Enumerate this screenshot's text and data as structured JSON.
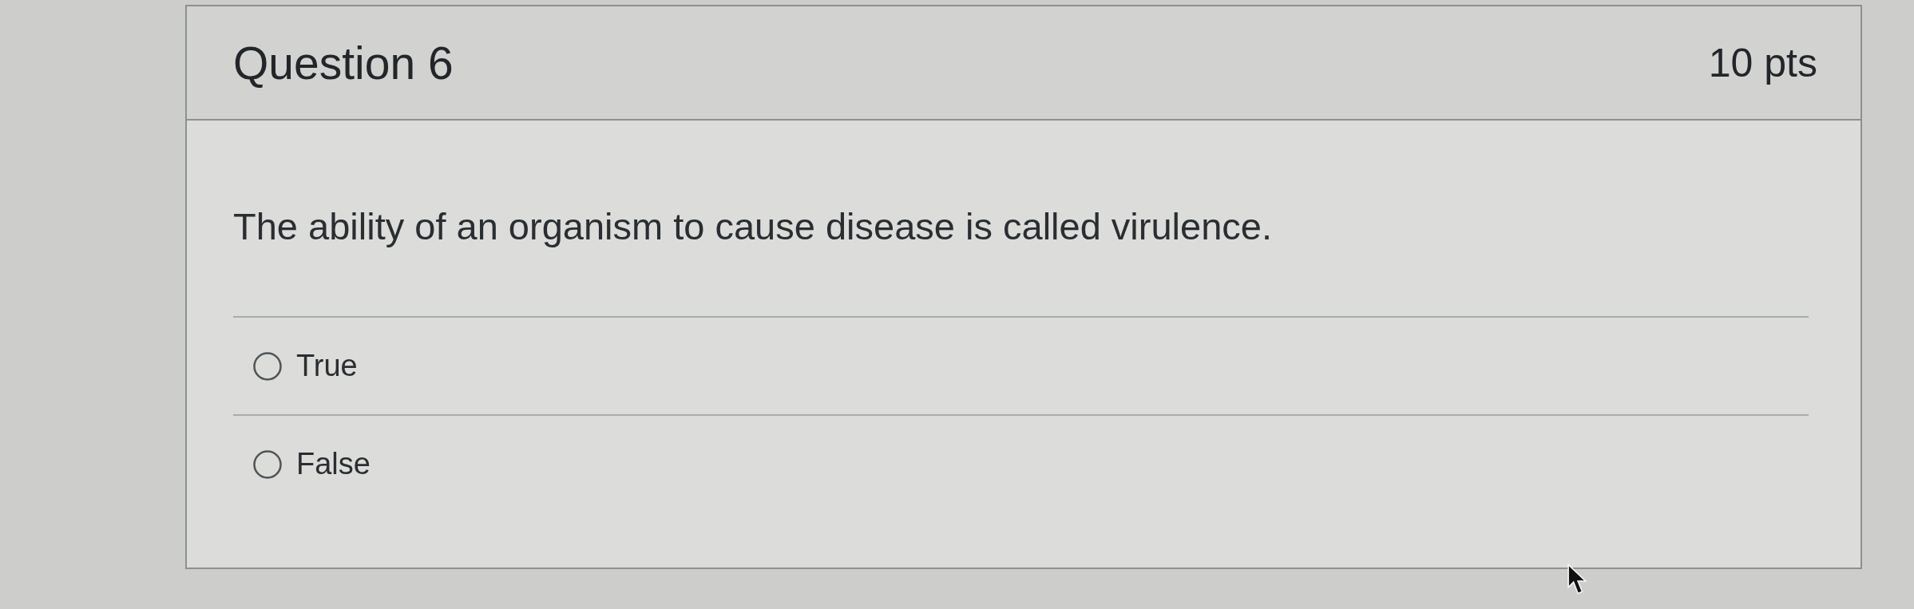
{
  "question": {
    "title": "Question 6",
    "points": "10 pts",
    "text": "The ability of an organism to cause disease is called virulence.",
    "answers": [
      {
        "label": "True",
        "selected": false
      },
      {
        "label": "False",
        "selected": false
      }
    ]
  }
}
